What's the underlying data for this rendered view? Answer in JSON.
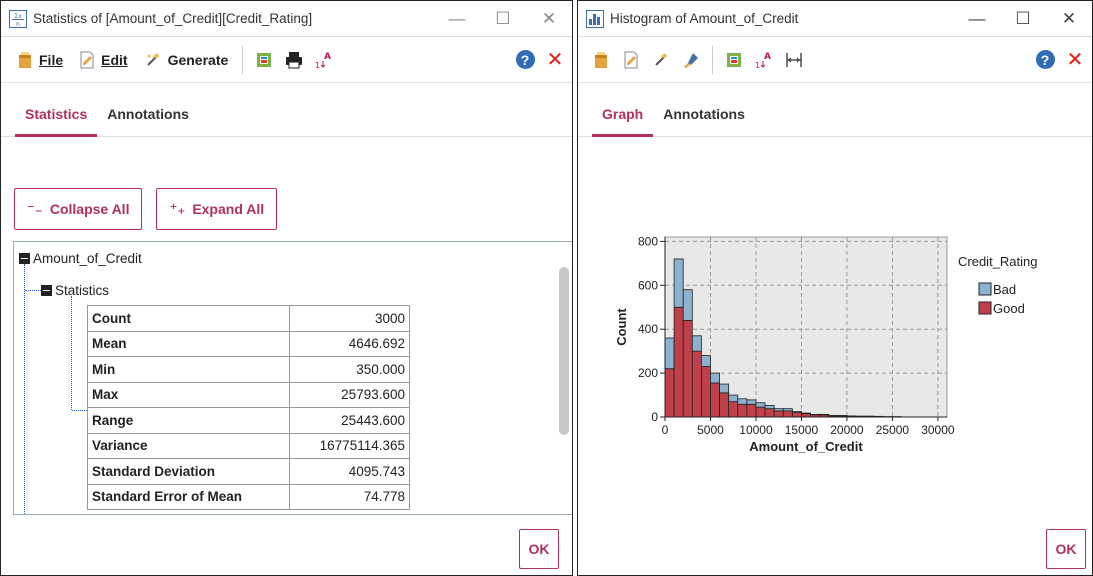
{
  "left_window": {
    "title": "Statistics of [Amount_of_Credit][Credit_Rating]",
    "controls": {
      "minimize": "—",
      "maximize": "☐",
      "close": "✕"
    },
    "toolbar": {
      "file_label": "File",
      "edit_label": "Edit",
      "generate_label": "Generate",
      "help": "?",
      "close": "✕"
    },
    "tabs": [
      {
        "label": "Statistics",
        "active": true
      },
      {
        "label": "Annotations",
        "active": false
      }
    ],
    "collapse_all_label": "Collapse All",
    "expand_all_label": "Expand All",
    "tree": {
      "root_label": "Amount_of_Credit",
      "child_label": "Statistics",
      "rows": [
        {
          "key": "Count",
          "value": "3000"
        },
        {
          "key": "Mean",
          "value": "4646.692"
        },
        {
          "key": "Min",
          "value": "350.000"
        },
        {
          "key": "Max",
          "value": "25793.600"
        },
        {
          "key": "Range",
          "value": "25443.600"
        },
        {
          "key": "Variance",
          "value": "16775114.365"
        },
        {
          "key": "Standard Deviation",
          "value": "4095.743"
        },
        {
          "key": "Standard Error of Mean",
          "value": "74.778"
        }
      ]
    },
    "ok_label": "OK"
  },
  "right_window": {
    "title": "Histogram of Amount_of_Credit",
    "controls": {
      "minimize": "—",
      "maximize": "☐",
      "close": "✕"
    },
    "toolbar": {
      "help": "?",
      "close": "✕"
    },
    "tabs": [
      {
        "label": "Graph",
        "active": true
      },
      {
        "label": "Annotations",
        "active": false
      }
    ],
    "ok_label": "OK"
  },
  "colors": {
    "accent": "#b03060",
    "bad": "#8bb3cf",
    "good": "#c0404a",
    "plot_bg": "#e8e8e8"
  },
  "chart_data": {
    "type": "bar",
    "stacked": true,
    "xlabel": "Amount_of_Credit",
    "ylabel": "Count",
    "xlim": [
      0,
      31000
    ],
    "ylim": [
      0,
      820
    ],
    "xticks": [
      0,
      5000,
      10000,
      15000,
      20000,
      25000,
      30000
    ],
    "yticks": [
      0,
      200,
      400,
      600,
      800
    ],
    "bin_width": 1000,
    "bin_starts": [
      0,
      1000,
      2000,
      3000,
      4000,
      5000,
      6000,
      7000,
      8000,
      9000,
      10000,
      11000,
      12000,
      13000,
      14000,
      15000,
      16000,
      17000,
      18000,
      19000,
      20000,
      21000,
      22000,
      23000,
      24000,
      25000
    ],
    "series": [
      {
        "name": "Good",
        "values": [
          220,
          500,
          440,
          300,
          230,
          155,
          110,
          70,
          58,
          58,
          45,
          38,
          28,
          28,
          20,
          15,
          10,
          10,
          5,
          5,
          3,
          3,
          3,
          2,
          2,
          2
        ]
      },
      {
        "name": "Bad",
        "values": [
          140,
          220,
          140,
          70,
          50,
          45,
          40,
          30,
          25,
          20,
          20,
          15,
          10,
          10,
          5,
          3,
          2,
          2,
          2,
          2,
          2,
          1,
          1,
          1,
          0,
          0
        ]
      }
    ],
    "legend": {
      "title": "Credit_Rating",
      "placement": "right",
      "entries": [
        "Bad",
        "Good"
      ]
    },
    "grid": true
  }
}
